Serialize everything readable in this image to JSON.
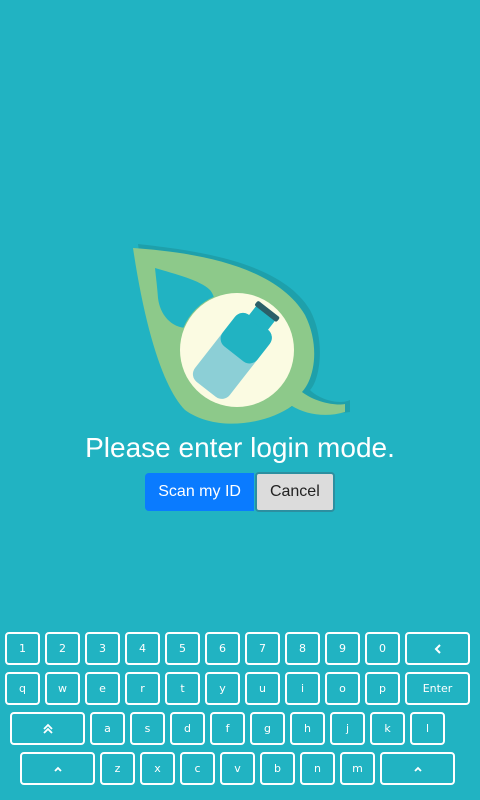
{
  "prompt": "Please enter login mode.",
  "buttons": {
    "scan": "Scan my ID",
    "cancel": "Cancel"
  },
  "keyboard": {
    "rows": [
      [
        "1",
        "2",
        "3",
        "4",
        "5",
        "6",
        "7",
        "8",
        "9",
        "0",
        "backspace"
      ],
      [
        "q",
        "w",
        "e",
        "r",
        "t",
        "y",
        "u",
        "i",
        "o",
        "p",
        "Enter"
      ],
      [
        "shift",
        "a",
        "s",
        "d",
        "f",
        "g",
        "h",
        "j",
        "k",
        "l"
      ],
      [
        "up-arrow",
        "z",
        "x",
        "c",
        "v",
        "b",
        "n",
        "m",
        "up-arrow"
      ]
    ],
    "enter_label": "Enter"
  },
  "colors": {
    "background": "#21b3c2",
    "primary_button": "#0a7bff",
    "secondary_button": "#dcdcdc",
    "logo_leaf": "#8dc98a",
    "logo_circle": "#fbfbe2",
    "logo_bottle": "#8ccfd6"
  },
  "icons": {
    "logo": "leaf-bottle-logo-icon"
  }
}
